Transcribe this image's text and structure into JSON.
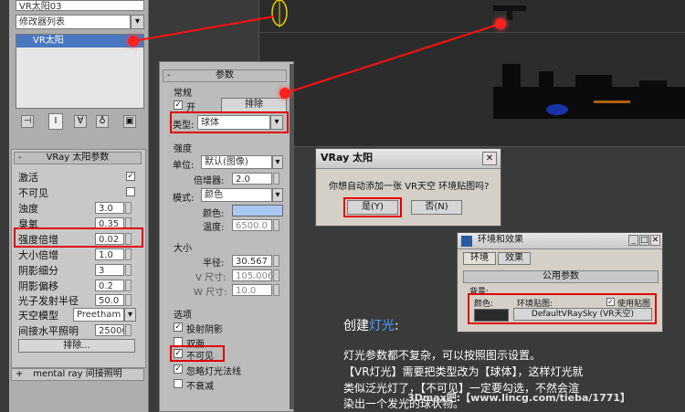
{
  "modifier_panel": {
    "object_name": "VR太阳03",
    "modifier_list": "修改器列表",
    "stack_item": "VR太阳"
  },
  "vray_sun": {
    "header": "VRay 太阳参数",
    "rows": [
      {
        "label": "激活",
        "type": "check",
        "checked": true
      },
      {
        "label": "不可见",
        "type": "check",
        "checked": false
      },
      {
        "label": "浊度",
        "value": "3.0"
      },
      {
        "label": "臭氧",
        "value": "0.35"
      },
      {
        "label": "强度倍增",
        "value": "0.02"
      },
      {
        "label": "大小倍增",
        "value": "1.0"
      },
      {
        "label": "阴影细分",
        "value": "3"
      },
      {
        "label": "阴影偏移",
        "value": "0.2"
      },
      {
        "label": "光子发射半径",
        "value": "50.0"
      },
      {
        "label": "天空模型",
        "value": "Preetham et"
      },
      {
        "label": "间接水平照明",
        "value": "25000."
      }
    ],
    "exclude_button": "排除...",
    "mental_ray": "mental ray 间接照明"
  },
  "vrlight": {
    "header": "参数",
    "general": "常规",
    "on_label": "开",
    "exclude_button": "排除",
    "type_label": "类型:",
    "type_value": "球体",
    "intensity": "强度",
    "unit_label": "单位:",
    "unit_value": "默认(图像)",
    "multiplier_label": "倍增器:",
    "multiplier_value": "2.0",
    "mode_label": "模式:",
    "mode_value": "颜色",
    "color_label": "颜色:",
    "temp_label": "温度:",
    "temp_value": "6500.0",
    "size": "大小",
    "radius_label": "半径:",
    "radius_value": "30.567",
    "v_label": "V 尺寸:",
    "v_value": "105.006",
    "w_label": "W 尺寸:",
    "w_value": "10.0",
    "options": "选项",
    "opt_cast": "投射阴影",
    "opt_double": "双面",
    "opt_invisible": "不可见",
    "opt_ignore": "忽略灯光法线",
    "opt_nodecay": "不衰减"
  },
  "vray_dialog": {
    "title": "VRay 太阳",
    "message": "你想自动添加一张 VR天空 环境贴图吗?",
    "yes": "是(Y)",
    "no": "否(N)"
  },
  "env_dialog": {
    "title": "环境和效果",
    "tab1": "环境",
    "tab2": "效果",
    "section": "公用参数",
    "background": "背景:",
    "color_label": "颜色:",
    "envmap_label": "环境贴图:",
    "use_map": "使用贴图",
    "map_button": "DefaultVRaySky (VR天空)"
  },
  "annotation": {
    "heading_a": "创建",
    "heading_b": "灯光",
    "heading_c": ":",
    "line1": "灯光参数都不复杂，可以按照图示设置。",
    "line2": "【VR灯光】需要把类型改为【球体】，这样灯光就",
    "line3": "类似泛光灯了，【不可见】一定要勾选，不然会渲",
    "line4": "染出一个发光的球状物。",
    "watermark": "3Dmax吧:【www.lincg.com/tieba/1771】"
  },
  "colors": {
    "accent_red": "#e00000",
    "highlight_blue": "#4aa0ff"
  }
}
